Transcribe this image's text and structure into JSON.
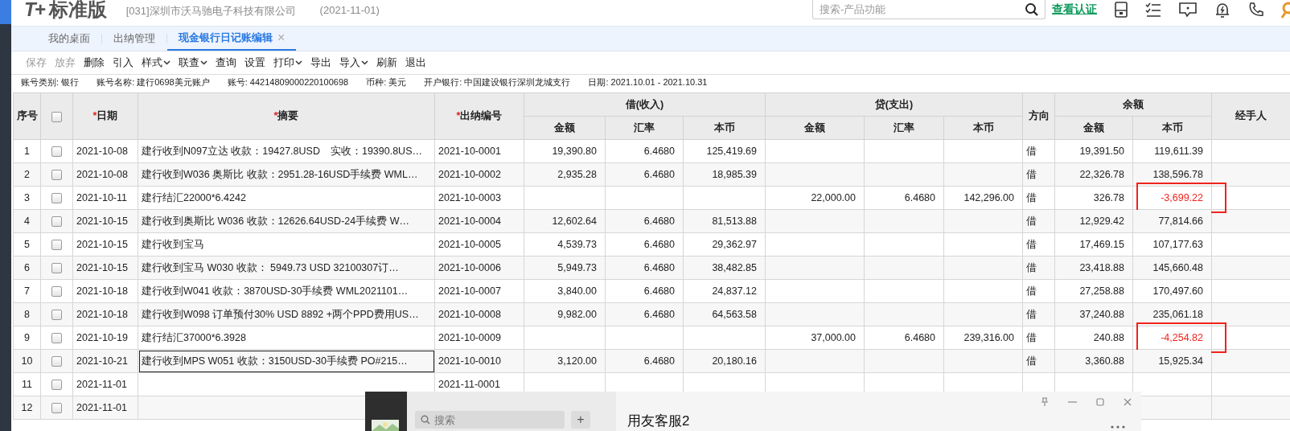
{
  "header": {
    "logo": "T+",
    "edition": "标准版",
    "company": "[031]深圳市沃马驰电子科技有限公司",
    "date": "(2021-11-01)",
    "search": {
      "placeholder": "搜索-产品功能"
    },
    "verify_link": "查看认证"
  },
  "tabs": [
    {
      "label": "我的桌面",
      "selected": false,
      "closable": false
    },
    {
      "label": "出纳管理",
      "selected": false,
      "closable": false
    },
    {
      "label": "现金银行日记账编辑",
      "selected": true,
      "closable": true,
      "close": "×"
    }
  ],
  "toolbar": [
    {
      "label": "保存",
      "disabled": true,
      "dropdown": false
    },
    {
      "label": "放弃",
      "disabled": true,
      "dropdown": false
    },
    {
      "label": "删除",
      "disabled": false,
      "dropdown": false
    },
    {
      "label": "引入",
      "disabled": false,
      "dropdown": false
    },
    {
      "label": "样式",
      "disabled": false,
      "dropdown": true
    },
    {
      "label": "联查",
      "disabled": false,
      "dropdown": true
    },
    {
      "label": "查询",
      "disabled": false,
      "dropdown": false
    },
    {
      "label": "设置",
      "disabled": false,
      "dropdown": false
    },
    {
      "label": "打印",
      "disabled": false,
      "dropdown": true
    },
    {
      "label": "导出",
      "disabled": false,
      "dropdown": false
    },
    {
      "label": "导入",
      "disabled": false,
      "dropdown": true
    },
    {
      "label": "刷新",
      "disabled": false,
      "dropdown": false
    },
    {
      "label": "退出",
      "disabled": false,
      "dropdown": false
    }
  ],
  "account_info": [
    {
      "label": "账号类别:",
      "value": "银行"
    },
    {
      "label": "账号名称:",
      "value": "建行0698美元账户"
    },
    {
      "label": "账号:",
      "value": "44214809000220100698"
    },
    {
      "label": "币种:",
      "value": "美元"
    },
    {
      "label": "开户银行:",
      "value": "中国建设银行深圳龙城支行"
    },
    {
      "label": "日期:",
      "value": "2021.10.01 - 2021.10.31"
    }
  ],
  "table": {
    "header": {
      "no": "序号",
      "select_all": {
        "checked": false
      },
      "date": {
        "marker": "*",
        "label": "日期"
      },
      "summary": {
        "marker": "*",
        "label": "摘要"
      },
      "voucher": {
        "marker": "*",
        "label": "出纳编号"
      },
      "debit": {
        "label": "借(收入)",
        "columns": [
          "金额",
          "汇率",
          "本币"
        ]
      },
      "credit": {
        "label": "贷(支出)",
        "columns": [
          "金额",
          "汇率",
          "本币"
        ]
      },
      "direction": "方向",
      "balance": {
        "label": "余额",
        "columns": [
          "金额",
          "本币"
        ]
      },
      "handler": "经手人"
    },
    "rows": [
      {
        "no": "1",
        "checked": false,
        "date": "2021-10-08",
        "summary": "建行收到N097立达 收款：19427.8USD　实收：19390.8US…",
        "voucher": "2021-10-0001",
        "debit": [
          "19,390.80",
          "6.4680",
          "125,419.69"
        ],
        "direction": "借",
        "balance": [
          "19,391.50",
          "119,611.39"
        ],
        "negative": false,
        "annotated": false,
        "focused": false
      },
      {
        "no": "2",
        "checked": false,
        "date": "2021-10-08",
        "summary": "建行收到W036 奥斯比 收款：2951.28-16USD手续费  WML…",
        "voucher": "2021-10-0002",
        "debit": [
          "2,935.28",
          "6.4680",
          "18,985.39"
        ],
        "direction": "借",
        "balance": [
          "22,326.78",
          "138,596.78"
        ],
        "negative": false,
        "annotated": false,
        "focused": false
      },
      {
        "no": "3",
        "checked": false,
        "date": "2021-10-11",
        "summary": "建行结汇22000*6.4242",
        "voucher": "2021-10-0003",
        "credit": [
          "22,000.00",
          "6.4680",
          "142,296.00"
        ],
        "direction": "借",
        "balance": [
          "326.78",
          "-3,699.22"
        ],
        "negative": true,
        "annotated": true,
        "focused": false
      },
      {
        "no": "4",
        "checked": false,
        "date": "2021-10-15",
        "summary": "建行收到奥斯比 W036  收款：12626.64USD-24手续费   W…",
        "voucher": "2021-10-0004",
        "debit": [
          "12,602.64",
          "6.4680",
          "81,513.88"
        ],
        "direction": "借",
        "balance": [
          "12,929.42",
          "77,814.66"
        ],
        "negative": false,
        "annotated": false,
        "focused": false
      },
      {
        "no": "5",
        "checked": false,
        "date": "2021-10-15",
        "summary": "建行收到宝马",
        "voucher": "2021-10-0005",
        "debit": [
          "4,539.73",
          "6.4680",
          "29,362.97"
        ],
        "direction": "借",
        "balance": [
          "17,469.15",
          "107,177.63"
        ],
        "negative": false,
        "annotated": false,
        "focused": false
      },
      {
        "no": "6",
        "checked": false,
        "date": "2021-10-15",
        "summary": "建行收到宝马 W030  收款： 5949.73 USD     32100307订…",
        "voucher": "2021-10-0006",
        "debit": [
          "5,949.73",
          "6.4680",
          "38,482.85"
        ],
        "direction": "借",
        "balance": [
          "23,418.88",
          "145,660.48"
        ],
        "negative": false,
        "annotated": false,
        "focused": false
      },
      {
        "no": "7",
        "checked": false,
        "date": "2021-10-18",
        "summary": "建行收到W041  收款：3870USD-30手续费   WML2021101…",
        "voucher": "2021-10-0007",
        "debit": [
          "3,840.00",
          "6.4680",
          "24,837.12"
        ],
        "direction": "借",
        "balance": [
          "27,258.88",
          "170,497.60"
        ],
        "negative": false,
        "annotated": false,
        "focused": false
      },
      {
        "no": "8",
        "checked": false,
        "date": "2021-10-18",
        "summary": "建行收到W098 订单预付30% USD 8892 +两个PPD费用US…",
        "voucher": "2021-10-0008",
        "debit": [
          "9,982.00",
          "6.4680",
          "64,563.58"
        ],
        "direction": "借",
        "balance": [
          "37,240.88",
          "235,061.18"
        ],
        "negative": false,
        "annotated": false,
        "focused": false
      },
      {
        "no": "9",
        "checked": false,
        "date": "2021-10-19",
        "summary": "建行结汇37000*6.3928",
        "voucher": "2021-10-0009",
        "credit": [
          "37,000.00",
          "6.4680",
          "239,316.00"
        ],
        "direction": "借",
        "balance": [
          "240.88",
          "-4,254.82"
        ],
        "negative": true,
        "annotated": true,
        "focused": false
      },
      {
        "no": "10",
        "checked": false,
        "date": "2021-10-21",
        "summary": "建行收到MPS W051  收款：3150USD-30手续费   PO#215…",
        "voucher": "2021-10-0010",
        "debit": [
          "3,120.00",
          "6.4680",
          "20,180.16"
        ],
        "direction": "借",
        "balance": [
          "3,360.88",
          "15,925.34"
        ],
        "negative": false,
        "annotated": false,
        "focused": true
      },
      {
        "no": "11",
        "checked": false,
        "date": "2021-11-01",
        "voucher": "2021-11-0001",
        "annotated": false,
        "focused": false
      },
      {
        "no": "12",
        "checked": false,
        "date": "2021-11-01",
        "annotated": false,
        "focused": false
      }
    ]
  },
  "chat_popup": {
    "search": {
      "placeholder": "搜索"
    },
    "add": "+",
    "title": "用友客服2"
  }
}
